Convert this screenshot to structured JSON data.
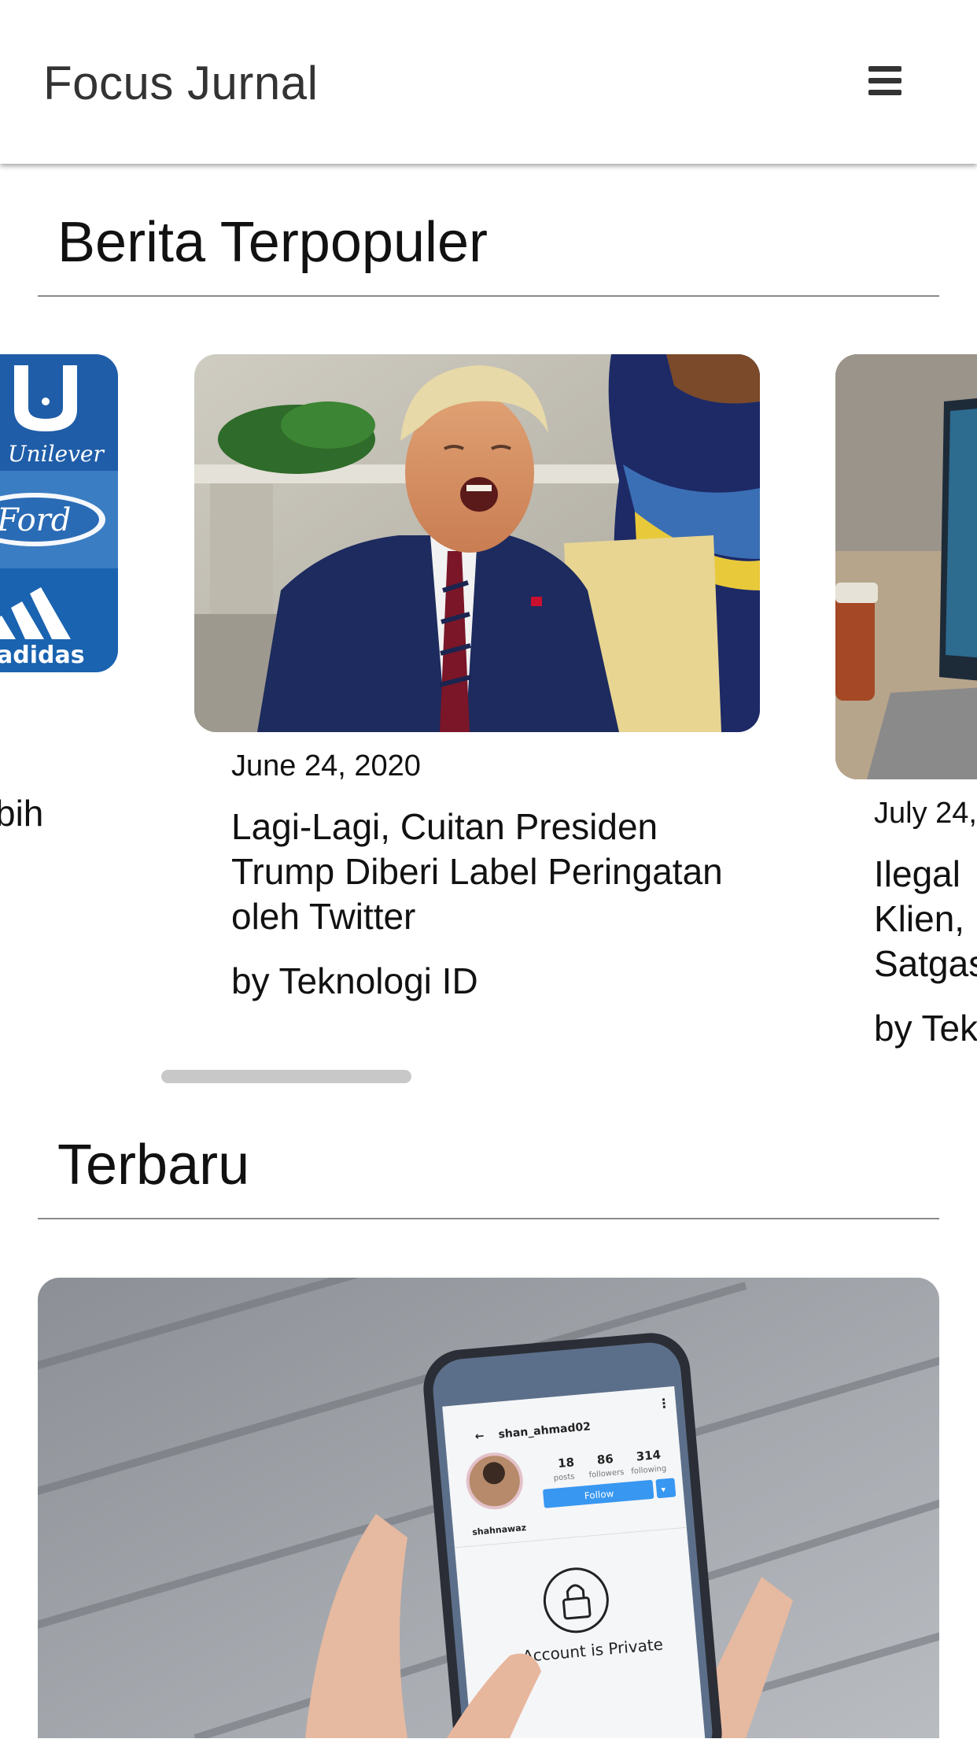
{
  "appbar": {
    "title": "Focus Jurnal"
  },
  "popular": {
    "title": "Berita Terpopuler",
    "cards": [
      {
        "title_fragment": "bih",
        "logos": [
          "Unilever",
          "Ford",
          "adidas"
        ]
      },
      {
        "date": "June 24, 2020",
        "title": "Lagi-Lagi, Cuitan Presiden Trump Diberi Label Peringatan oleh Twitter",
        "author": "by Teknologi ID"
      },
      {
        "date": "July 24,",
        "title_lines": [
          "Ilegal",
          "Klien,",
          "Satgas"
        ],
        "author": "by Tek"
      }
    ]
  },
  "latest": {
    "title": "Terbaru",
    "phone": {
      "username": "shan_ahmad02",
      "posts_count": "18",
      "posts_label": "posts",
      "followers_count": "86",
      "followers_label": "followers",
      "following_count": "314",
      "following_label": "following",
      "follow_button": "Follow",
      "name": "shahnawaz",
      "private_text": "Account is Private"
    }
  },
  "colors": {
    "appbar_text": "#333333",
    "rule": "#8a8a8a",
    "scrollbar": "#c8c8c8",
    "unilever_blue": "#1f5da8",
    "follow_blue": "#3897f0"
  },
  "icons": {
    "menu": "hamburger-menu-icon",
    "back": "arrow-left-icon",
    "more": "more-vertical-icon",
    "lock": "lock-icon"
  }
}
